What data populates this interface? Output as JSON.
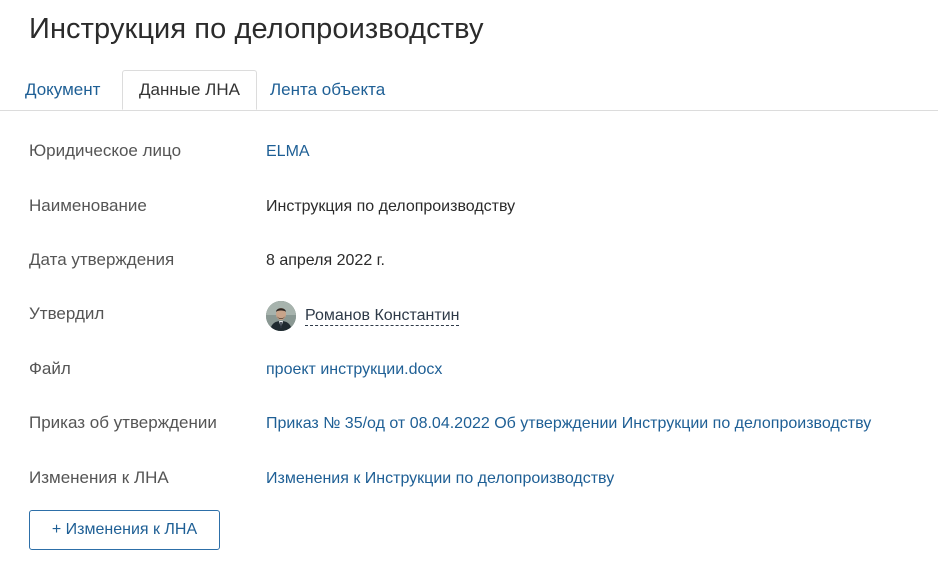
{
  "page": {
    "title": "Инструкция по делопроизводству"
  },
  "tabs": [
    {
      "label": "Документ",
      "active": false
    },
    {
      "label": "Данные ЛНА",
      "active": true
    },
    {
      "label": "Лента объекта",
      "active": false
    }
  ],
  "fields": {
    "legal_entity": {
      "label": "Юридическое лицо",
      "value": "ELMA"
    },
    "name": {
      "label": "Наименование",
      "value": "Инструкция по делопроизводству"
    },
    "approval_date": {
      "label": "Дата утверждения",
      "value": "8 апреля 2022 г."
    },
    "approved_by": {
      "label": "Утвердил",
      "value": "Романов Константин"
    },
    "file": {
      "label": "Файл",
      "value": "проект инструкции.docx"
    },
    "approval_order": {
      "label": "Приказ об утверждении",
      "value": "Приказ № 35/од от 08.04.2022 Об утверждении Инструкции по делопроизводству"
    },
    "changes": {
      "label": "Изменения к ЛНА",
      "value": "Изменения к Инструкции по делопроизводству"
    }
  },
  "actions": {
    "add_changes_label": "+ Изменения к ЛНА"
  },
  "colors": {
    "link": "#1e5f95",
    "text": "#333333",
    "label": "#555555",
    "border": "#dcdcdc",
    "button_border": "#2d6fa8"
  },
  "icons": {
    "approver_avatar": "user-avatar-photo"
  }
}
